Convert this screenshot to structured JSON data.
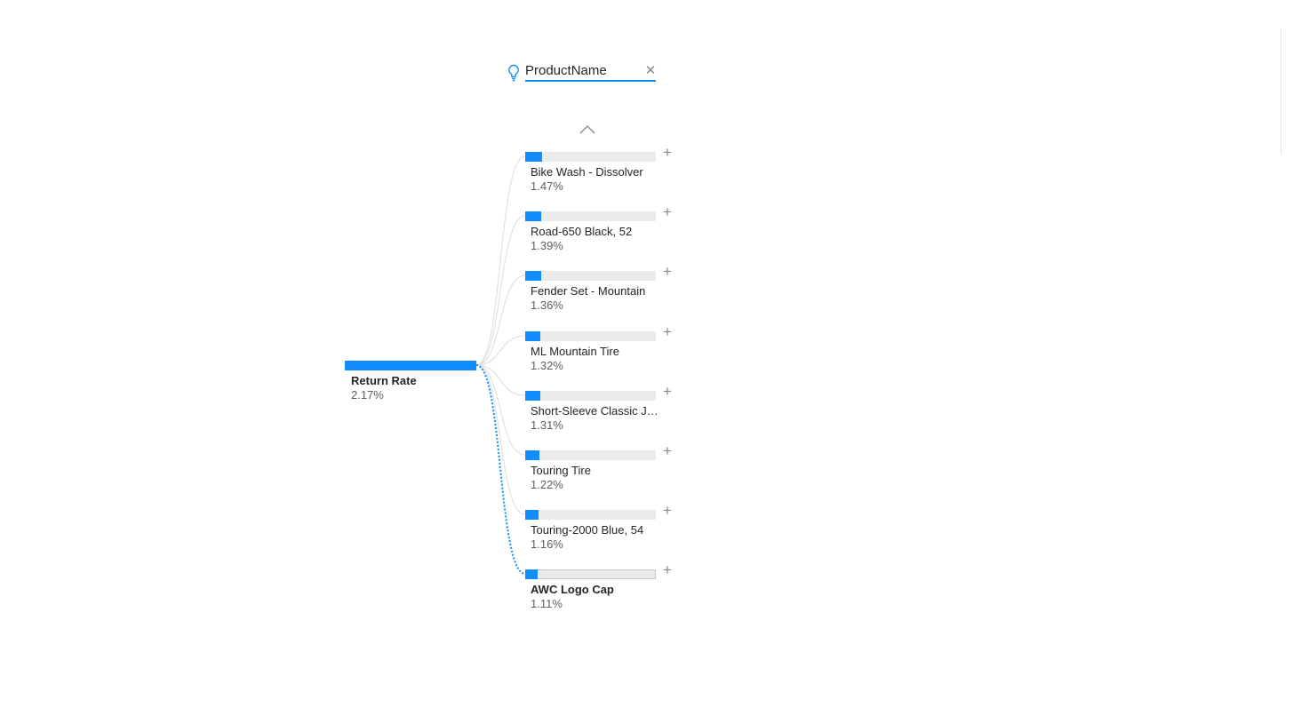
{
  "level": {
    "title": "ProductName",
    "close_icon": "close-icon",
    "hint_icon": "lightbulb-icon"
  },
  "root": {
    "label": "Return Rate",
    "value": "2.17%",
    "fraction": 1.0
  },
  "children": [
    {
      "label": "Bike Wash - Dissolver",
      "value": "1.47%",
      "percent": 1.47,
      "selected": false
    },
    {
      "label": "Road-650 Black, 52",
      "value": "1.39%",
      "percent": 1.39,
      "selected": false
    },
    {
      "label": "Fender Set - Mountain",
      "value": "1.36%",
      "percent": 1.36,
      "selected": false
    },
    {
      "label": "ML Mountain Tire",
      "value": "1.32%",
      "percent": 1.32,
      "selected": false
    },
    {
      "label": "Short-Sleeve Classic Jersey",
      "value": "1.31%",
      "percent": 1.31,
      "selected": false
    },
    {
      "label": "Touring Tire",
      "value": "1.22%",
      "percent": 1.22,
      "selected": false
    },
    {
      "label": "Touring-2000 Blue, 54",
      "value": "1.16%",
      "percent": 1.16,
      "selected": false
    },
    {
      "label": "AWC Logo Cap",
      "value": "1.11%",
      "percent": 1.11,
      "selected": true
    }
  ],
  "colors": {
    "accent": "#118dff",
    "track": "#ebebeb",
    "connector": "#e1e1e1"
  }
}
